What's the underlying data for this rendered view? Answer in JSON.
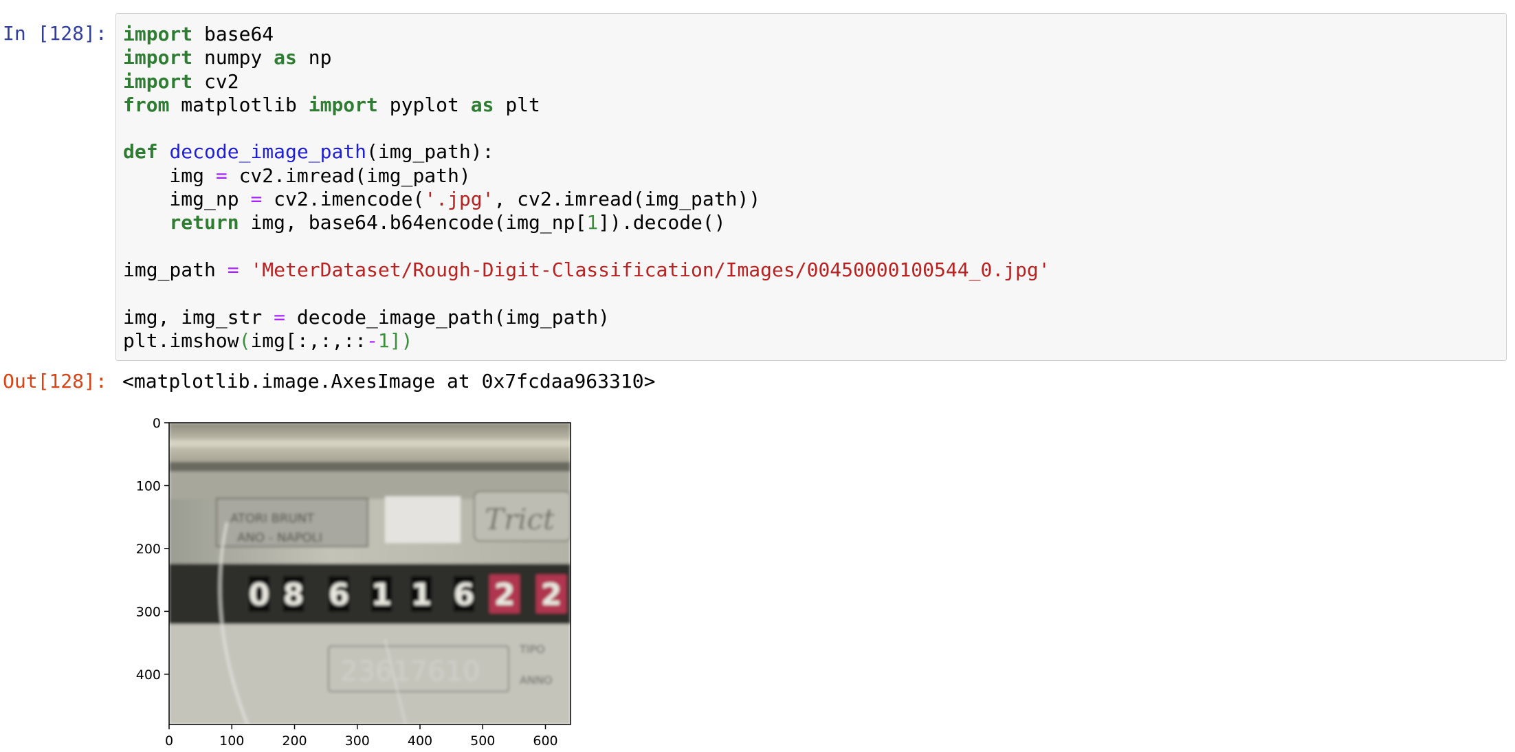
{
  "cell": {
    "in_prompt": "In [128]:",
    "out_prompt": "Out[128]:",
    "output_text": "<matplotlib.image.AxesImage at 0x7fcdaa963310>",
    "code_lines": [
      [
        {
          "t": "import",
          "c": "kw"
        },
        {
          "t": " base64"
        }
      ],
      [
        {
          "t": "import",
          "c": "kw"
        },
        {
          "t": " numpy "
        },
        {
          "t": "as",
          "c": "kw"
        },
        {
          "t": " np"
        }
      ],
      [
        {
          "t": "import",
          "c": "kw"
        },
        {
          "t": " cv2"
        }
      ],
      [
        {
          "t": "from",
          "c": "kw"
        },
        {
          "t": " matplotlib "
        },
        {
          "t": "import",
          "c": "kw"
        },
        {
          "t": " pyplot "
        },
        {
          "t": "as",
          "c": "kw"
        },
        {
          "t": " plt"
        }
      ],
      [],
      [
        {
          "t": "def",
          "c": "kw"
        },
        {
          "t": " "
        },
        {
          "t": "decode_image_path",
          "c": "fn"
        },
        {
          "t": "(img_path):"
        }
      ],
      [
        {
          "t": "    img "
        },
        {
          "t": "=",
          "c": "op"
        },
        {
          "t": " cv2.imread(img_path)"
        }
      ],
      [
        {
          "t": "    img_np "
        },
        {
          "t": "=",
          "c": "op"
        },
        {
          "t": " cv2.imencode("
        },
        {
          "t": "'.jpg'",
          "c": "str"
        },
        {
          "t": ", cv2.imread(img_path))"
        }
      ],
      [
        {
          "t": "    "
        },
        {
          "t": "return",
          "c": "kw"
        },
        {
          "t": " img, base64.b64encode(img_np["
        },
        {
          "t": "1",
          "c": "num"
        },
        {
          "t": "]).decode()"
        }
      ],
      [],
      [
        {
          "t": "img_path "
        },
        {
          "t": "=",
          "c": "op"
        },
        {
          "t": " "
        },
        {
          "t": "'MeterDataset/Rough-Digit-Classification/Images/00450000100544_0.jpg'",
          "c": "str"
        }
      ],
      [],
      [
        {
          "t": "img, img_str "
        },
        {
          "t": "=",
          "c": "op"
        },
        {
          "t": " decode_image_path(img_path)"
        }
      ],
      [
        {
          "t": "plt.imshow"
        },
        {
          "t": "(",
          "c": "br"
        },
        {
          "t": "img[:,:,::"
        },
        {
          "t": "-",
          "c": "op"
        },
        {
          "t": "1",
          "c": "num"
        },
        {
          "t": "])",
          "c": "br"
        }
      ]
    ]
  },
  "chart_data": {
    "type": "image",
    "x_ticks": [
      "0",
      "100",
      "200",
      "300",
      "400",
      "500",
      "600"
    ],
    "y_ticks": [
      "0",
      "100",
      "200",
      "300",
      "400"
    ],
    "xlim": [
      0,
      640
    ],
    "ylim": [
      480,
      0
    ],
    "x_tick_values": [
      0,
      100,
      200,
      300,
      400,
      500,
      600
    ],
    "y_tick_values": [
      0,
      100,
      200,
      300,
      400
    ],
    "image_content": {
      "odometer_digits": [
        "0",
        "8",
        "6",
        "1",
        "1",
        "6",
        "2",
        "2"
      ],
      "red_digit_count": 2,
      "label_text": "ATORI BRUNT",
      "label_text_2": "ANO - NAPOLI",
      "serial_text": "23617610",
      "tipo_text": "TIPO",
      "anno_text": "ANNO"
    }
  }
}
